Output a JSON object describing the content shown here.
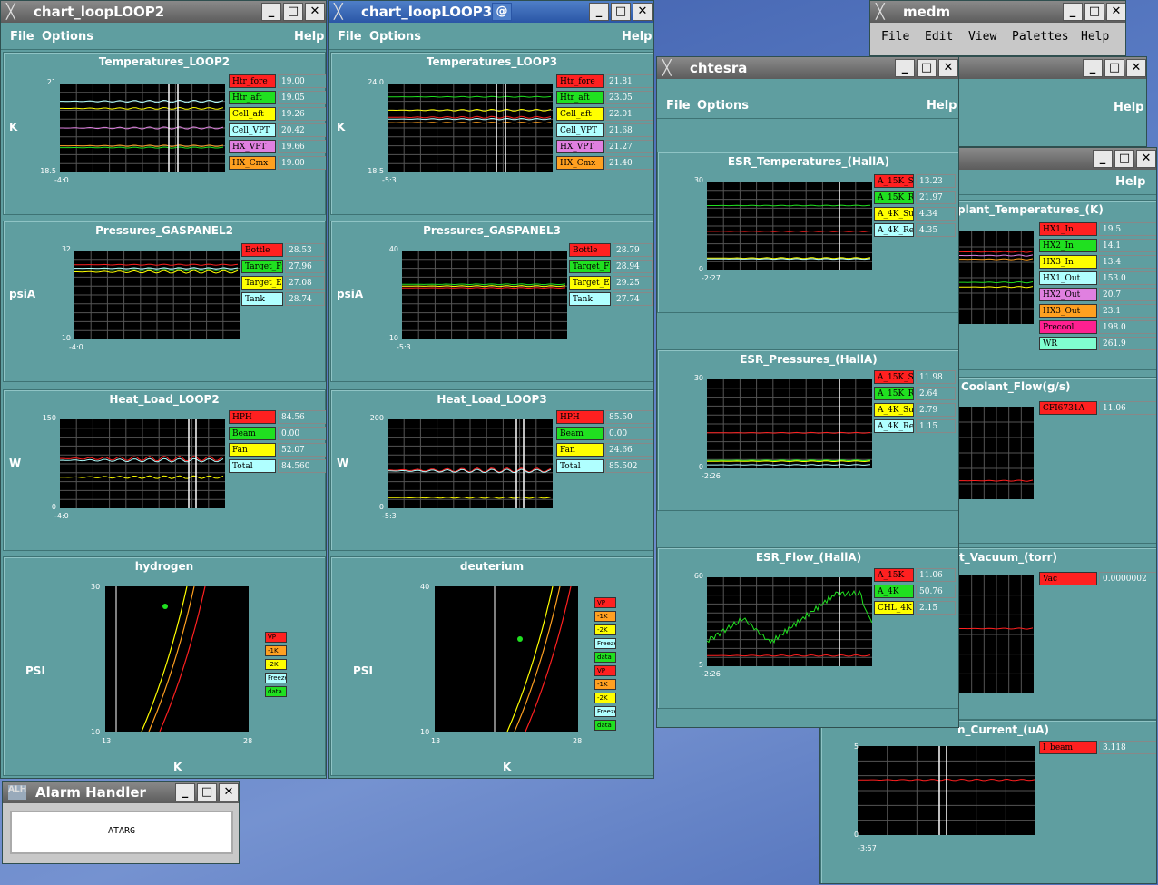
{
  "menu": {
    "file": "File",
    "options": "Options",
    "help": "Help"
  },
  "loop2": {
    "title": "chart_loopLOOP2",
    "temp": {
      "title": "Temperatures_LOOP2",
      "unit": "K",
      "ymax": "21",
      "ymin": "18.5",
      "xmin": "-4:0",
      "items": [
        {
          "label": "Htr_fore",
          "value": "19.00",
          "color": "#ff2020"
        },
        {
          "label": "Htr_aft",
          "value": "19.05",
          "color": "#20e020"
        },
        {
          "label": "Cell_aft",
          "value": "19.26",
          "color": "#ffff00"
        },
        {
          "label": "Cell_VPT",
          "value": "20.42",
          "color": "#b0ffff"
        },
        {
          "label": "HX_VPT",
          "value": "19.66",
          "color": "#e080e0"
        },
        {
          "label": "HX_Cmx",
          "value": "19.00",
          "color": "#ffa020"
        }
      ]
    },
    "press": {
      "title": "Pressures_GASPANEL2",
      "unit": "psiA",
      "ymax": "32",
      "ymin": "10",
      "xmin": "-4:0",
      "items": [
        {
          "label": "Bottle",
          "value": "28.53",
          "color": "#ff2020"
        },
        {
          "label": "Target_Fi",
          "value": "27.96",
          "color": "#20e020"
        },
        {
          "label": "Target_Ex",
          "value": "27.08",
          "color": "#ffff00"
        },
        {
          "label": "Tank",
          "value": "28.74",
          "color": "#b0ffff"
        }
      ]
    },
    "heat": {
      "title": "Heat_Load_LOOP2",
      "unit": "W",
      "ymax": "150",
      "ymin": "0",
      "xmin": "-4:0",
      "items": [
        {
          "label": "HPH",
          "value": "84.56",
          "color": "#ff2020"
        },
        {
          "label": "Beam",
          "value": "0.00",
          "color": "#20e020"
        },
        {
          "label": "Fan",
          "value": "52.07",
          "color": "#ffff00"
        },
        {
          "label": "Total",
          "value": "84.560",
          "color": "#b0ffff"
        }
      ]
    },
    "phase": {
      "title": "hydrogen",
      "ylabel": "PSI",
      "xlabel": "K",
      "ymax": "30",
      "ymin": "10",
      "xmin": "13",
      "xmax": "28",
      "legend": [
        {
          "label": "VP",
          "color": "#ff2020"
        },
        {
          "label": "-1K",
          "color": "#ffa020"
        },
        {
          "label": "-2K",
          "color": "#ffff00"
        },
        {
          "label": "Freeze",
          "color": "#b0ffff"
        },
        {
          "label": "data",
          "color": "#20e020"
        }
      ]
    }
  },
  "loop3": {
    "title": "chart_loopLOOP3",
    "temp": {
      "title": "Temperatures_LOOP3",
      "unit": "K",
      "ymax": "24.0",
      "ymin": "18.5",
      "xmin": "-5:3",
      "items": [
        {
          "label": "Htr_fore",
          "value": "21.81",
          "color": "#ff2020"
        },
        {
          "label": "Htr_aft",
          "value": "23.05",
          "color": "#20e020"
        },
        {
          "label": "Cell_aft",
          "value": "22.01",
          "color": "#ffff00"
        },
        {
          "label": "Cell_VPT",
          "value": "21.68",
          "color": "#b0ffff"
        },
        {
          "label": "HX_VPT",
          "value": "21.27",
          "color": "#e080e0"
        },
        {
          "label": "HX_Cmx",
          "value": "21.40",
          "color": "#ffa020"
        }
      ]
    },
    "press": {
      "title": "Pressures_GASPANEL3",
      "unit": "psiA",
      "ymax": "40",
      "ymin": "10",
      "xmin": "-5:3",
      "items": [
        {
          "label": "Bottle",
          "value": "28.79",
          "color": "#ff2020"
        },
        {
          "label": "Target_Fi",
          "value": "28.94",
          "color": "#20e020"
        },
        {
          "label": "Target_Ex",
          "value": "29.25",
          "color": "#ffff00"
        },
        {
          "label": "Tank",
          "value": "27.74",
          "color": "#b0ffff"
        }
      ]
    },
    "heat": {
      "title": "Heat_Load_LOOP3",
      "unit": "W",
      "ymax": "200",
      "ymin": "0",
      "xmin": "-5:3",
      "items": [
        {
          "label": "HPH",
          "value": "85.50",
          "color": "#ff2020"
        },
        {
          "label": "Beam",
          "value": "0.00",
          "color": "#20e020"
        },
        {
          "label": "Fan",
          "value": "24.66",
          "color": "#ffff00"
        },
        {
          "label": "Total",
          "value": "85.502",
          "color": "#b0ffff"
        }
      ]
    },
    "phase": {
      "title": "deuterium",
      "ylabel": "PSI",
      "xlabel": "K",
      "ymax": "40",
      "ymin": "10",
      "xmin": "13",
      "xmax": "28",
      "legend": [
        {
          "label": "VP",
          "color": "#ff2020"
        },
        {
          "label": "-1K",
          "color": "#ffa020"
        },
        {
          "label": "-2K",
          "color": "#ffff00"
        },
        {
          "label": "Freeze",
          "color": "#b0ffff"
        },
        {
          "label": "data",
          "color": "#20e020"
        },
        {
          "label": "VP",
          "color": "#ff2020"
        },
        {
          "label": "-1K",
          "color": "#ffa020"
        },
        {
          "label": "-2K",
          "color": "#ffff00"
        },
        {
          "label": "Freeze",
          "color": "#b0ffff"
        },
        {
          "label": "data",
          "color": "#20e020"
        }
      ]
    }
  },
  "chtesra": {
    "title": "chtesra",
    "temp": {
      "title": "ESR_Temperatures_(HallA)",
      "ymax": "30",
      "ymin": "0",
      "xmin": "-2:27",
      "items": [
        {
          "label": "A_15K_S",
          "value": "13.23",
          "color": "#ff2020"
        },
        {
          "label": "A_15K_R",
          "value": "21.97",
          "color": "#20e020"
        },
        {
          "label": "A_4K_Su",
          "value": "4.34",
          "color": "#ffff00"
        },
        {
          "label": "A_4K_Re",
          "value": "4.35",
          "color": "#b0ffff"
        }
      ]
    },
    "press": {
      "title": "ESR_Pressures_(HallA)",
      "ymax": "30",
      "ymin": "0",
      "xmin": "-2:26",
      "items": [
        {
          "label": "A_15K_S",
          "value": "11.98",
          "color": "#ff2020"
        },
        {
          "label": "A_15K_R",
          "value": "2.64",
          "color": "#20e020"
        },
        {
          "label": "A_4K_Su",
          "value": "2.79",
          "color": "#ffff00"
        },
        {
          "label": "A_4K_Re",
          "value": "1.15",
          "color": "#b0ffff"
        }
      ]
    },
    "flow": {
      "title": "ESR_Flow_(HallA)",
      "ymax": "60",
      "ymin": "5",
      "xmin": "-2:26",
      "items": [
        {
          "label": "A_15K",
          "value": "11.06",
          "color": "#ff2020"
        },
        {
          "label": "A_4K",
          "value": "50.76",
          "color": "#20e020"
        },
        {
          "label": "CHL_4K",
          "value": "2.15",
          "color": "#ffff00"
        }
      ]
    }
  },
  "medm": {
    "title": "medm",
    "menu": [
      "File",
      "Edit",
      "View",
      "Palettes",
      "Help"
    ]
  },
  "back": {
    "help": "Help",
    "coolant_temp": {
      "title": "plant_Temperatures_(K)",
      "items": [
        {
          "label": "HX1_In",
          "value": "19.5",
          "color": "#ff2020"
        },
        {
          "label": "HX2_In",
          "value": "14.1",
          "color": "#20e020"
        },
        {
          "label": "HX3_In",
          "value": "13.4",
          "color": "#ffff00"
        },
        {
          "label": "HX1_Out",
          "value": "153.0",
          "color": "#b0ffff"
        },
        {
          "label": "HX2_Out",
          "value": "20.7",
          "color": "#e080e0"
        },
        {
          "label": "HX3_Out",
          "value": "23.1",
          "color": "#ffa020"
        },
        {
          "label": "Precool",
          "value": "198.0",
          "color": "#ff2090"
        },
        {
          "label": "WR",
          "value": "261.9",
          "color": "#80ffd0"
        }
      ]
    },
    "coolant_flow": {
      "title": "Coolant_Flow(g/s)",
      "items": [
        {
          "label": "CFI6731A",
          "value": "11.06",
          "color": "#ff2020"
        }
      ]
    },
    "vacuum": {
      "title": "t_Vacuum_(torr)",
      "items": [
        {
          "label": "Vac",
          "value": "0.0000002",
          "color": "#ff2020"
        }
      ]
    },
    "current": {
      "title": "n_Current_(uA)",
      "ymax": "5",
      "ymin": "0",
      "xmin": "-3:57",
      "items": [
        {
          "label": "I_beam",
          "value": "3.118",
          "color": "#ff2020"
        }
      ]
    }
  },
  "alarm": {
    "title": "Alarm Handler",
    "label": "ATARG"
  }
}
